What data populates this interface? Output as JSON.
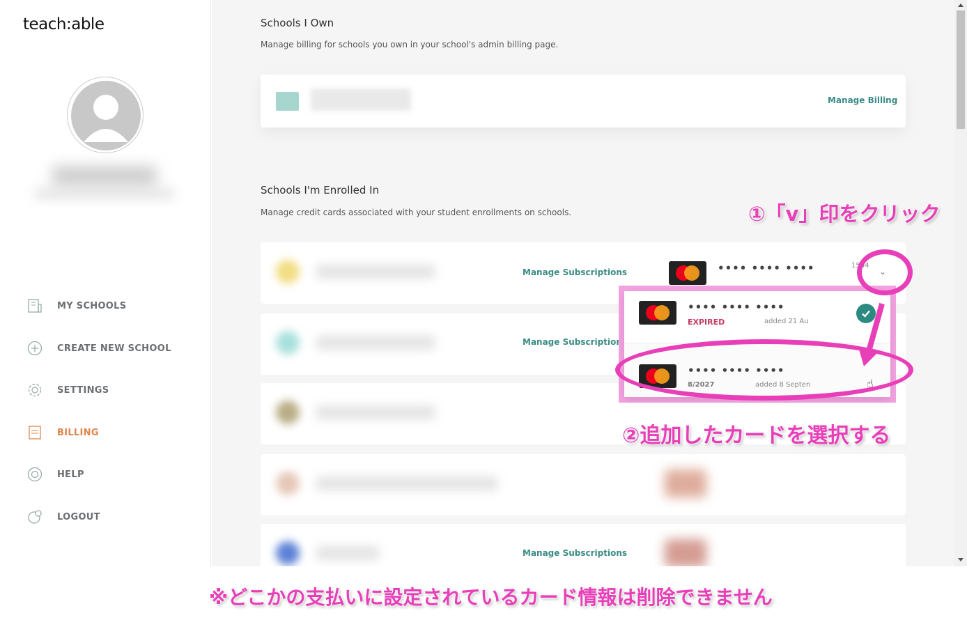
{
  "brand": {
    "logo_text": "teach:able"
  },
  "sidebar": {
    "items": [
      {
        "label": "MY SCHOOLS",
        "icon": "building-icon",
        "active": false
      },
      {
        "label": "CREATE NEW SCHOOL",
        "icon": "plus-circle-icon",
        "active": false
      },
      {
        "label": "SETTINGS",
        "icon": "gear-icon",
        "active": false
      },
      {
        "label": "BILLING",
        "icon": "receipt-icon",
        "active": true
      },
      {
        "label": "HELP",
        "icon": "lifebuoy-icon",
        "active": false
      },
      {
        "label": "LOGOUT",
        "icon": "logout-icon",
        "active": false
      }
    ]
  },
  "owned": {
    "title": "Schools I Own",
    "description": "Manage billing for schools you own in your school's admin billing page.",
    "manage_billing": "Manage Billing"
  },
  "enrolled": {
    "title": "Schools I'm Enrolled In",
    "description": "Manage credit cards associated with your student enrollments on schools.",
    "manage_subscriptions": "Manage Subscriptions",
    "card_digits": "1504",
    "card_dots": "•••• •••• ••••"
  },
  "dropdown": {
    "cards": [
      {
        "dots": "•••• •••• ••••",
        "status": "EXPIRED",
        "added": "added 21 Au",
        "selected": true
      },
      {
        "dots": "•••• •••• ••••",
        "status": "8/2027",
        "added": "added 8 Septen",
        "selected": false
      }
    ]
  },
  "annotations": {
    "step1": "①「v」印をクリック",
    "step2": "②追加したカードを選択する",
    "note": "※どこかの支払いに設定されているカード情報は削除できません"
  },
  "colors": {
    "accent": "#3b8c84",
    "billing_active": "#e0854e",
    "annotation": "#e83fb9",
    "expired": "#c53b63"
  }
}
